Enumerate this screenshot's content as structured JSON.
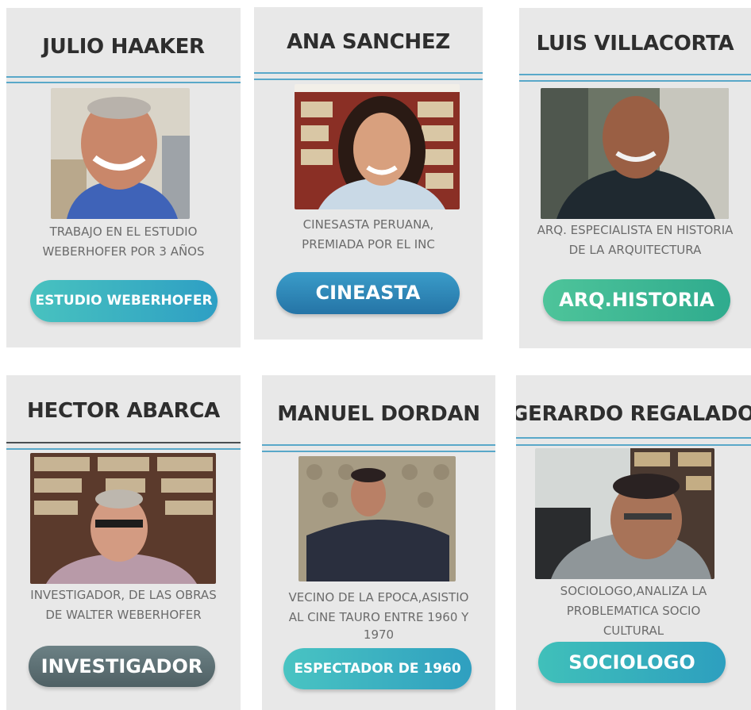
{
  "cards": [
    {
      "name": "JULIO HAAKER",
      "description": [
        "TRABAJO EN EL ESTUDIO",
        "WEBERHOFER POR 3 AÑOS"
      ],
      "button": "ESTUDIO WEBERHOFER",
      "button_color": "#3fb6c1"
    },
    {
      "name": "ANA SANCHEZ",
      "description": [
        "CINESASTA PERUANA,",
        "PREMIADA POR EL INC"
      ],
      "button": "CINEASTA",
      "button_color": "#2f86b6"
    },
    {
      "name": "LUIS VILLACORTA",
      "description": [
        "ARQ. ESPECIALISTA EN HISTORIA",
        "DE LA ARQUITECTURA"
      ],
      "button": "ARQ.HISTORIA",
      "button_color": "#49bc97"
    },
    {
      "name": "HECTOR ABARCA",
      "description": [
        "INVESTIGADOR, DE LAS OBRAS",
        "DE WALTER WEBERHOFER"
      ],
      "button": "INVESTIGADOR",
      "button_color": "#5c7378"
    },
    {
      "name": "MANUEL DORDAN",
      "description": [
        "VECINO DE LA EPOCA,ASISTIO",
        "AL CINE TAURO ENTRE 1960 Y",
        "1970"
      ],
      "button": "ESPECTADOR DE 1960",
      "button_color": "#3fb6c1"
    },
    {
      "name": "GERARDO REGALADO",
      "description": [
        "SOCIOLOGO,ANALIZA LA",
        "PROBLEMATICA SOCIO",
        "CULTURAL"
      ],
      "button": "SOCIOLOGO",
      "button_color": "#35b4b0"
    }
  ]
}
